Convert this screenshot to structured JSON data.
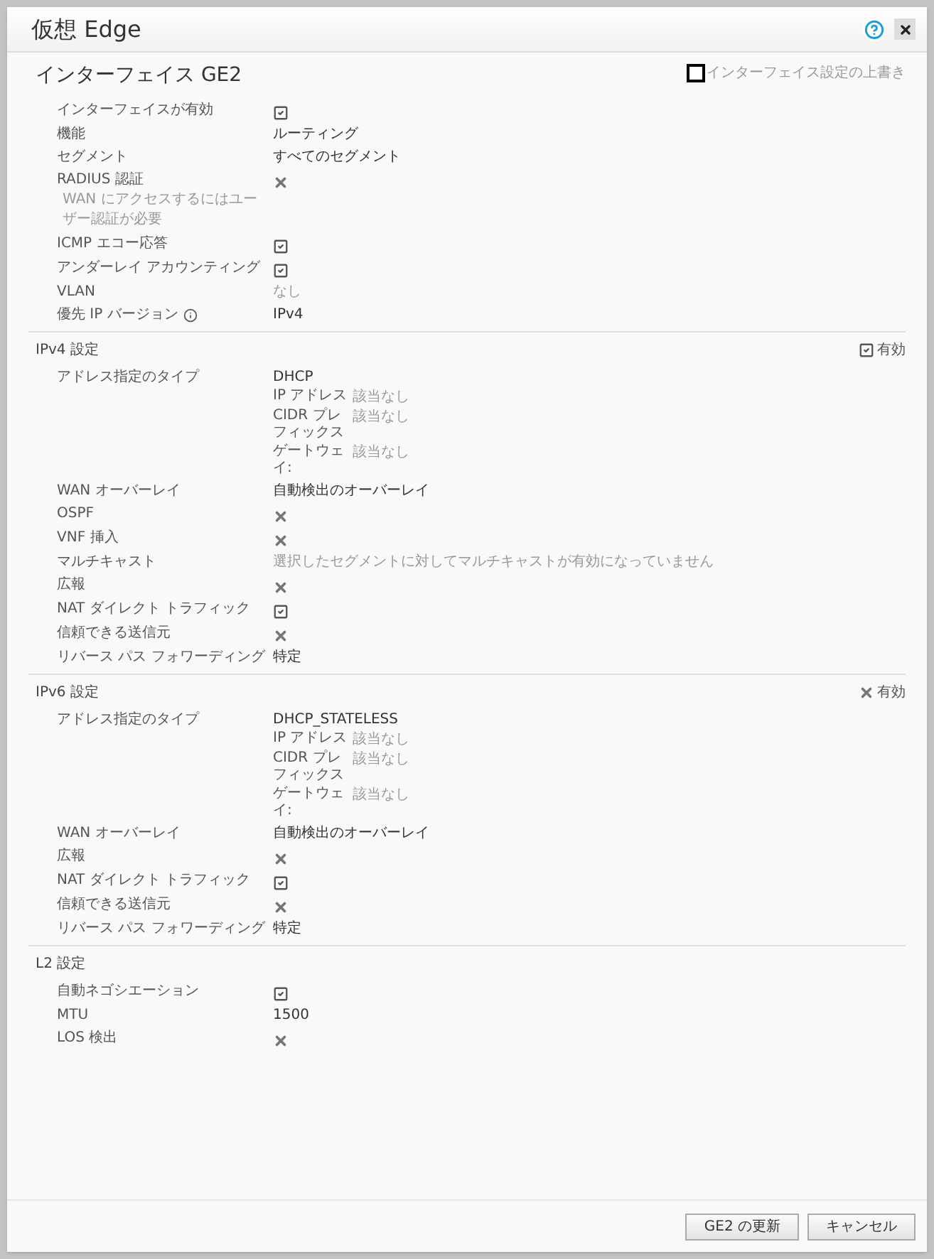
{
  "window": {
    "title": "仮想 Edge"
  },
  "interface": {
    "title": "インターフェイス GE2",
    "override": {
      "label": "インターフェイス設定の上書き",
      "checked": false
    }
  },
  "sections": [
    {
      "rows": [
        {
          "kind": "check",
          "label": "インターフェイスが有効",
          "checked": true
        },
        {
          "kind": "text",
          "label": "機能",
          "value": "ルーティング",
          "muted": false
        },
        {
          "kind": "text",
          "label": "セグメント",
          "value": "すべてのセグメント",
          "muted": false
        },
        {
          "kind": "check",
          "label": "RADIUS 認証",
          "note": "WAN にアクセスするにはユーザー認証が必要",
          "checked": false
        },
        {
          "kind": "check",
          "label": "ICMP エコー応答",
          "checked": true
        },
        {
          "kind": "check",
          "label": "アンダーレイ アカウンティング",
          "checked": true
        },
        {
          "kind": "text",
          "label": "VLAN",
          "value": "なし",
          "muted": true
        },
        {
          "kind": "text",
          "label": "優先 IP バージョン",
          "info": true,
          "value": "IPv4",
          "muted": false
        }
      ]
    },
    {
      "title": "IPv4 設定",
      "status": {
        "label": "有効",
        "enabled": true
      },
      "rows": [
        {
          "kind": "address",
          "label": "アドレス指定のタイプ",
          "value": "DHCP",
          "details": [
            {
              "label": "IP アドレス",
              "value": "該当なし"
            },
            {
              "label": "CIDR プレフィックス",
              "value": "該当なし"
            },
            {
              "label": "ゲートウェイ:",
              "value": "該当なし"
            }
          ]
        },
        {
          "kind": "text",
          "label": "WAN オーバーレイ",
          "value": "自動検出のオーバーレイ",
          "muted": false
        },
        {
          "kind": "check",
          "label": "OSPF",
          "checked": false
        },
        {
          "kind": "check",
          "label": "VNF 挿入",
          "checked": false
        },
        {
          "kind": "text",
          "label": "マルチキャスト",
          "value": "選択したセグメントに対してマルチキャストが有効になっていません",
          "muted": true
        },
        {
          "kind": "check",
          "label": "広報",
          "checked": false
        },
        {
          "kind": "check",
          "label": "NAT ダイレクト トラフィック",
          "checked": true
        },
        {
          "kind": "check",
          "label": "信頼できる送信元",
          "checked": false
        },
        {
          "kind": "text",
          "label": "リバース パス フォワーディング",
          "value": "特定",
          "muted": false
        }
      ]
    },
    {
      "title": "IPv6 設定",
      "status": {
        "label": "有効",
        "enabled": false
      },
      "rows": [
        {
          "kind": "address",
          "label": "アドレス指定のタイプ",
          "value": "DHCP_STATELESS",
          "details": [
            {
              "label": "IP アドレス",
              "value": "該当なし"
            },
            {
              "label": "CIDR プレフィックス",
              "value": "該当なし"
            },
            {
              "label": "ゲートウェイ:",
              "value": "該当なし"
            }
          ]
        },
        {
          "kind": "text",
          "label": "WAN オーバーレイ",
          "value": "自動検出のオーバーレイ",
          "muted": false
        },
        {
          "kind": "check",
          "label": "広報",
          "checked": false
        },
        {
          "kind": "check",
          "label": "NAT ダイレクト トラフィック",
          "checked": true
        },
        {
          "kind": "check",
          "label": "信頼できる送信元",
          "checked": false
        },
        {
          "kind": "text",
          "label": "リバース パス フォワーディング",
          "value": "特定",
          "muted": false
        }
      ]
    },
    {
      "title": "L2 設定",
      "rows": [
        {
          "kind": "check",
          "label": "自動ネゴシエーション",
          "checked": true
        },
        {
          "kind": "text",
          "label": "MTU",
          "value": "1500",
          "muted": false
        },
        {
          "kind": "check",
          "label": "LOS 検出",
          "checked": false
        }
      ]
    }
  ],
  "buttons": [
    "GE2 の更新",
    "キャンセル"
  ]
}
